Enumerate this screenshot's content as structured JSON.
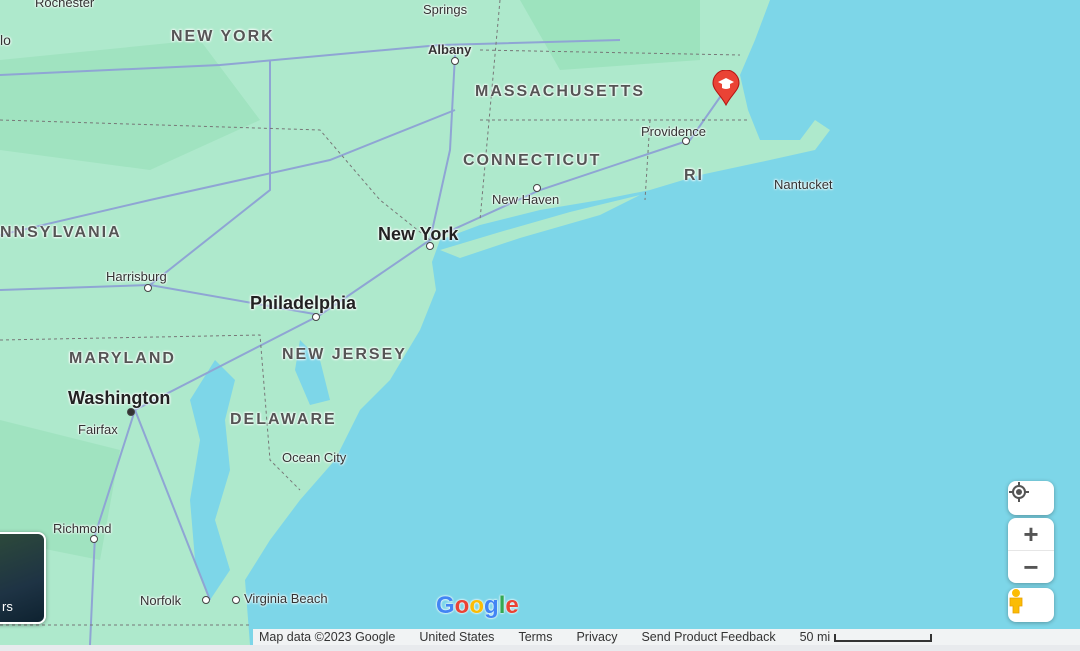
{
  "map": {
    "colors": {
      "water": "#7dd6e8",
      "land": "#aee9cc",
      "land_dark": "#96dfb8",
      "road": "#8fa5d4",
      "marker": "#ea4335"
    },
    "states": [
      "NEW YORK",
      "MASSACHUSETTS",
      "CONNECTICUT",
      "RI",
      "NNSYLVANIA",
      "MARYLAND",
      "NEW JERSEY",
      "DELAWARE"
    ],
    "cities": [
      "Rochester",
      "lo",
      "Springs",
      "Albany",
      "Providence",
      "Nantucket",
      "New Haven",
      "Harrisburg",
      "Fairfax",
      "Ocean City",
      "Richmond",
      "Norfolk",
      "Virginia Beach"
    ],
    "major_cities": [
      "New York",
      "Philadelphia",
      "Washington"
    ],
    "marker_icon": "graduation-cap-icon",
    "layer_thumb_label": "rs"
  },
  "controls": {
    "locate_icon": "my-location-icon",
    "zoom_in": "+",
    "zoom_out": "−",
    "pegman_icon": "pegman-icon"
  },
  "logo": "Google",
  "footer": {
    "map_data": "Map data ©2023 Google",
    "region": "United States",
    "terms": "Terms",
    "privacy": "Privacy",
    "feedback": "Send Product Feedback",
    "scale": "50 mi"
  }
}
